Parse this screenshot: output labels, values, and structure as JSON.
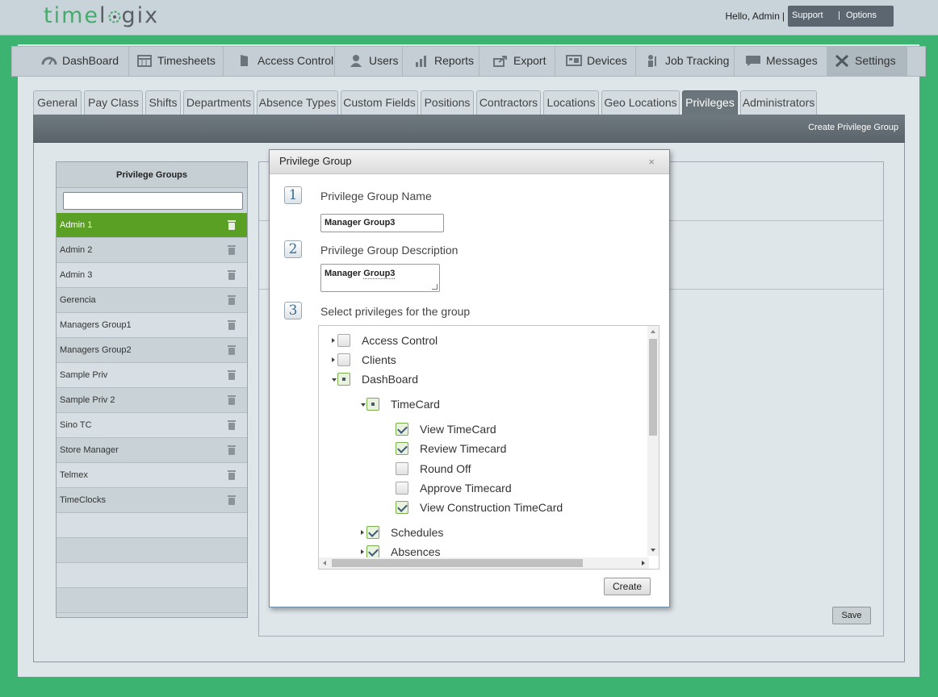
{
  "header": {
    "logo_part1": "time",
    "logo_part2": "l",
    "logo_part3": "gix",
    "greeting": "Hello, Admin",
    "greeting_sep": "|",
    "support_label": "Support",
    "options_sep": "|",
    "options_label": "Options"
  },
  "nav": {
    "items": [
      {
        "label": "DashBoard",
        "icon": "gauge-icon"
      },
      {
        "label": "Timesheets",
        "icon": "calendar-icon"
      },
      {
        "label": "Access Control",
        "icon": "door-icon"
      },
      {
        "label": "Users",
        "icon": "user-icon"
      },
      {
        "label": "Reports",
        "icon": "bar-chart-icon"
      },
      {
        "label": "Export",
        "icon": "export-icon"
      },
      {
        "label": "Devices",
        "icon": "devices-icon"
      },
      {
        "label": "Job Tracking",
        "icon": "worker-icon"
      },
      {
        "label": "Messages",
        "icon": "chat-icon"
      },
      {
        "label": "Settings",
        "icon": "tools-icon"
      }
    ],
    "active": "Settings"
  },
  "tabs": {
    "items": [
      "General",
      "Pay Class",
      "Shifts",
      "Departments",
      "Absence Types",
      "Custom Fields",
      "Positions",
      "Contractors",
      "Locations",
      "Geo Locations",
      "Privileges",
      "Administrators"
    ],
    "active": "Privileges"
  },
  "toolbar": {
    "create_group_label": "Create Privilege Group"
  },
  "groups": {
    "title": "Privilege Groups",
    "search_value": "",
    "items": [
      "Admin 1",
      "Admin 2",
      "Admin 3",
      "Gerencia",
      "Managers Group1",
      "Managers Group2",
      "Sample Priv",
      "Sample Priv 2",
      "Sino TC",
      "Store Manager",
      "Telmex",
      "TimeClocks"
    ],
    "selected": "Admin 1"
  },
  "detail": {
    "save_label": "Save"
  },
  "modal": {
    "title": "Privilege Group",
    "close_label": "×",
    "step1_num": "1",
    "step1_label": "Privilege Group Name",
    "name_value": "Manager Group3",
    "step2_num": "2",
    "step2_label": "Privilege Group Description",
    "desc_value_a": "Manager ",
    "desc_value_b": "Group3",
    "step3_num": "3",
    "step3_label": "Select privileges for the group",
    "create_label": "Create",
    "tree": [
      {
        "label": "Access Control",
        "level": 0,
        "state": "off",
        "expander": "right"
      },
      {
        "label": "Clients",
        "level": 0,
        "state": "off",
        "expander": "right"
      },
      {
        "label": "DashBoard",
        "level": 0,
        "state": "part",
        "expander": "down"
      },
      {
        "label": "TimeCard",
        "level": 1,
        "state": "part",
        "expander": "down"
      },
      {
        "label": "View TimeCard",
        "level": 2,
        "state": "on",
        "expander": "none"
      },
      {
        "label": "Review Timecard",
        "level": 2,
        "state": "on",
        "expander": "none"
      },
      {
        "label": "Round Off",
        "level": 2,
        "state": "off",
        "expander": "none"
      },
      {
        "label": "Approve Timecard",
        "level": 2,
        "state": "off",
        "expander": "none"
      },
      {
        "label": "View Construction TimeCard",
        "level": 2,
        "state": "on",
        "expander": "none"
      },
      {
        "label": "Schedules",
        "level": 1,
        "state": "on",
        "expander": "right"
      },
      {
        "label": "Absences",
        "level": 1,
        "state": "on",
        "expander": "right"
      }
    ]
  },
  "colors": {
    "background": "#3cb371",
    "selected_group": "#5aa024",
    "logo_green": "#4aa96c",
    "active_tab": "#6b757c"
  }
}
